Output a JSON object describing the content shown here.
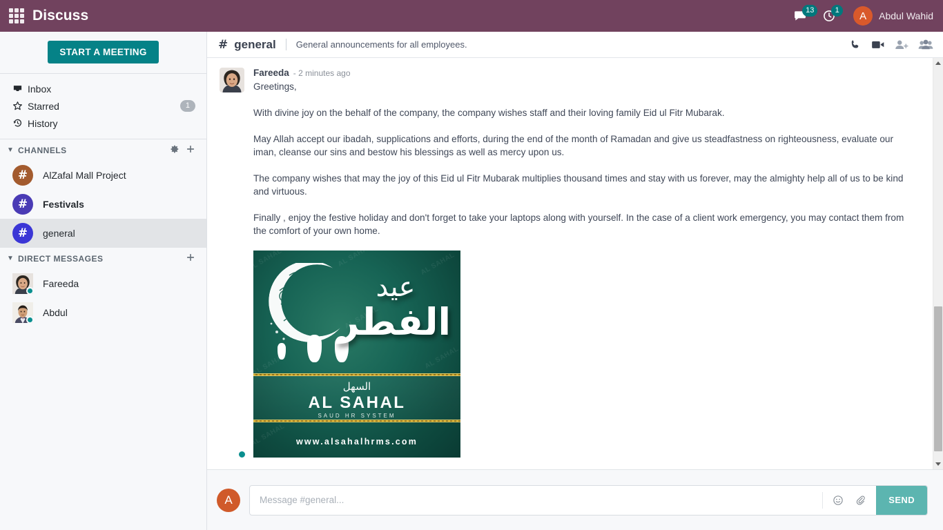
{
  "topbar": {
    "apps_icon": "apps-grid-icon",
    "title": "Discuss",
    "messaging_icon": "chat-bubble-icon",
    "messaging_count": "13",
    "activity_icon": "clock-activity-icon",
    "activity_count": "1",
    "user_initial": "A",
    "user_name": "Abdul Wahid",
    "bg_color": "#71425e"
  },
  "sidebar": {
    "start_meeting_label": "START A MEETING",
    "mailboxes": [
      {
        "icon": "inbox-icon",
        "label": "Inbox",
        "count": ""
      },
      {
        "icon": "star-icon",
        "label": "Starred",
        "count": "1"
      },
      {
        "icon": "history-icon",
        "label": "History",
        "count": ""
      }
    ],
    "channels_section": {
      "title": "CHANNELS",
      "caret_icon": "chevron-down-icon",
      "settings_icon": "gear-icon",
      "add_icon": "plus-icon"
    },
    "channels": [
      {
        "label": "AlZafal Mall Project",
        "color": "#a35b2e",
        "unread": false,
        "active": false
      },
      {
        "label": "Festivals",
        "color": "#4a3bb5",
        "unread": true,
        "active": false
      },
      {
        "label": "general",
        "color": "#3b36d6",
        "unread": false,
        "active": true
      }
    ],
    "dm_section": {
      "title": "DIRECT MESSAGES",
      "caret_icon": "chevron-down-icon",
      "add_icon": "plus-icon"
    },
    "direct_messages": [
      {
        "label": "Fareeda",
        "status": "online"
      },
      {
        "label": "Abdul",
        "status": "online"
      }
    ]
  },
  "channel_header": {
    "hash": "#",
    "name": "general",
    "description": "General announcements for all employees.",
    "actions": [
      {
        "icon": "phone-icon",
        "name": "start-call-button"
      },
      {
        "icon": "video-camera-icon",
        "name": "start-video-call-button"
      },
      {
        "icon": "add-user-icon",
        "name": "invite-people-button"
      },
      {
        "icon": "members-icon",
        "name": "show-members-button"
      }
    ]
  },
  "message": {
    "author": "Fareeda",
    "timestamp": "- 2 minutes ago",
    "paragraphs": [
      "Greetings,",
      "With divine joy on the behalf of the company, the company wishes staff and their loving family Eid ul Fitr Mubarak.",
      "May Allah accept our ibadah, supplications and efforts, during the end of the month of Ramadan and give us steadfastness on righteousness, evaluate our iman, cleanse our sins and bestow his blessings as well as mercy upon us.",
      "The company wishes that may the joy of this Eid ul Fitr Mubarak multiplies thousand times and stay with us forever, may the almighty help all of us to be kind and virtuous.",
      "Finally , enjoy the festive holiday and don't forget to take your laptops along with yourself. In the case of a client work emergency, you may contact them from the comfort of your own home."
    ],
    "attachment": {
      "type": "image",
      "arabic_line1": "عيد",
      "arabic_line2": "الفطر",
      "logo_arabic": "السهل",
      "logo_name": "AL SAHAL",
      "logo_tagline": "SAUD  HR  SYSTEM",
      "url": "www.alsahalhrms.com",
      "watermark": "AL SAHAL"
    }
  },
  "composer": {
    "avatar_initial": "A",
    "placeholder": "Message #general...",
    "value": "",
    "emoji_icon": "emoji-icon",
    "attach_icon": "paperclip-icon",
    "send_label": "SEND",
    "send_color": "#5cb5b0"
  },
  "scrollbar": {
    "up_icon": "scroll-up-arrow-icon",
    "down_icon": "scroll-down-arrow-icon"
  }
}
